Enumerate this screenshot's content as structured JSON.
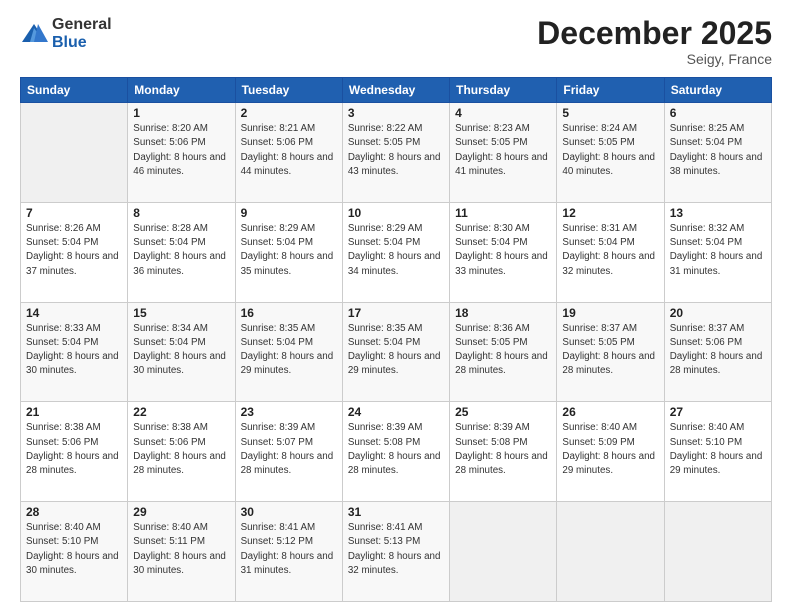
{
  "header": {
    "logo_line1": "General",
    "logo_line2": "Blue",
    "month_title": "December 2025",
    "location": "Seigy, France"
  },
  "days_of_week": [
    "Sunday",
    "Monday",
    "Tuesday",
    "Wednesday",
    "Thursday",
    "Friday",
    "Saturday"
  ],
  "weeks": [
    [
      {
        "num": "",
        "info": ""
      },
      {
        "num": "1",
        "info": "Sunrise: 8:20 AM\nSunset: 5:06 PM\nDaylight: 8 hours\nand 46 minutes."
      },
      {
        "num": "2",
        "info": "Sunrise: 8:21 AM\nSunset: 5:06 PM\nDaylight: 8 hours\nand 44 minutes."
      },
      {
        "num": "3",
        "info": "Sunrise: 8:22 AM\nSunset: 5:05 PM\nDaylight: 8 hours\nand 43 minutes."
      },
      {
        "num": "4",
        "info": "Sunrise: 8:23 AM\nSunset: 5:05 PM\nDaylight: 8 hours\nand 41 minutes."
      },
      {
        "num": "5",
        "info": "Sunrise: 8:24 AM\nSunset: 5:05 PM\nDaylight: 8 hours\nand 40 minutes."
      },
      {
        "num": "6",
        "info": "Sunrise: 8:25 AM\nSunset: 5:04 PM\nDaylight: 8 hours\nand 38 minutes."
      }
    ],
    [
      {
        "num": "7",
        "info": "Sunrise: 8:26 AM\nSunset: 5:04 PM\nDaylight: 8 hours\nand 37 minutes."
      },
      {
        "num": "8",
        "info": "Sunrise: 8:28 AM\nSunset: 5:04 PM\nDaylight: 8 hours\nand 36 minutes."
      },
      {
        "num": "9",
        "info": "Sunrise: 8:29 AM\nSunset: 5:04 PM\nDaylight: 8 hours\nand 35 minutes."
      },
      {
        "num": "10",
        "info": "Sunrise: 8:29 AM\nSunset: 5:04 PM\nDaylight: 8 hours\nand 34 minutes."
      },
      {
        "num": "11",
        "info": "Sunrise: 8:30 AM\nSunset: 5:04 PM\nDaylight: 8 hours\nand 33 minutes."
      },
      {
        "num": "12",
        "info": "Sunrise: 8:31 AM\nSunset: 5:04 PM\nDaylight: 8 hours\nand 32 minutes."
      },
      {
        "num": "13",
        "info": "Sunrise: 8:32 AM\nSunset: 5:04 PM\nDaylight: 8 hours\nand 31 minutes."
      }
    ],
    [
      {
        "num": "14",
        "info": "Sunrise: 8:33 AM\nSunset: 5:04 PM\nDaylight: 8 hours\nand 30 minutes."
      },
      {
        "num": "15",
        "info": "Sunrise: 8:34 AM\nSunset: 5:04 PM\nDaylight: 8 hours\nand 30 minutes."
      },
      {
        "num": "16",
        "info": "Sunrise: 8:35 AM\nSunset: 5:04 PM\nDaylight: 8 hours\nand 29 minutes."
      },
      {
        "num": "17",
        "info": "Sunrise: 8:35 AM\nSunset: 5:04 PM\nDaylight: 8 hours\nand 29 minutes."
      },
      {
        "num": "18",
        "info": "Sunrise: 8:36 AM\nSunset: 5:05 PM\nDaylight: 8 hours\nand 28 minutes."
      },
      {
        "num": "19",
        "info": "Sunrise: 8:37 AM\nSunset: 5:05 PM\nDaylight: 8 hours\nand 28 minutes."
      },
      {
        "num": "20",
        "info": "Sunrise: 8:37 AM\nSunset: 5:06 PM\nDaylight: 8 hours\nand 28 minutes."
      }
    ],
    [
      {
        "num": "21",
        "info": "Sunrise: 8:38 AM\nSunset: 5:06 PM\nDaylight: 8 hours\nand 28 minutes."
      },
      {
        "num": "22",
        "info": "Sunrise: 8:38 AM\nSunset: 5:06 PM\nDaylight: 8 hours\nand 28 minutes."
      },
      {
        "num": "23",
        "info": "Sunrise: 8:39 AM\nSunset: 5:07 PM\nDaylight: 8 hours\nand 28 minutes."
      },
      {
        "num": "24",
        "info": "Sunrise: 8:39 AM\nSunset: 5:08 PM\nDaylight: 8 hours\nand 28 minutes."
      },
      {
        "num": "25",
        "info": "Sunrise: 8:39 AM\nSunset: 5:08 PM\nDaylight: 8 hours\nand 28 minutes."
      },
      {
        "num": "26",
        "info": "Sunrise: 8:40 AM\nSunset: 5:09 PM\nDaylight: 8 hours\nand 29 minutes."
      },
      {
        "num": "27",
        "info": "Sunrise: 8:40 AM\nSunset: 5:10 PM\nDaylight: 8 hours\nand 29 minutes."
      }
    ],
    [
      {
        "num": "28",
        "info": "Sunrise: 8:40 AM\nSunset: 5:10 PM\nDaylight: 8 hours\nand 30 minutes."
      },
      {
        "num": "29",
        "info": "Sunrise: 8:40 AM\nSunset: 5:11 PM\nDaylight: 8 hours\nand 30 minutes."
      },
      {
        "num": "30",
        "info": "Sunrise: 8:41 AM\nSunset: 5:12 PM\nDaylight: 8 hours\nand 31 minutes."
      },
      {
        "num": "31",
        "info": "Sunrise: 8:41 AM\nSunset: 5:13 PM\nDaylight: 8 hours\nand 32 minutes."
      },
      {
        "num": "",
        "info": ""
      },
      {
        "num": "",
        "info": ""
      },
      {
        "num": "",
        "info": ""
      }
    ]
  ]
}
